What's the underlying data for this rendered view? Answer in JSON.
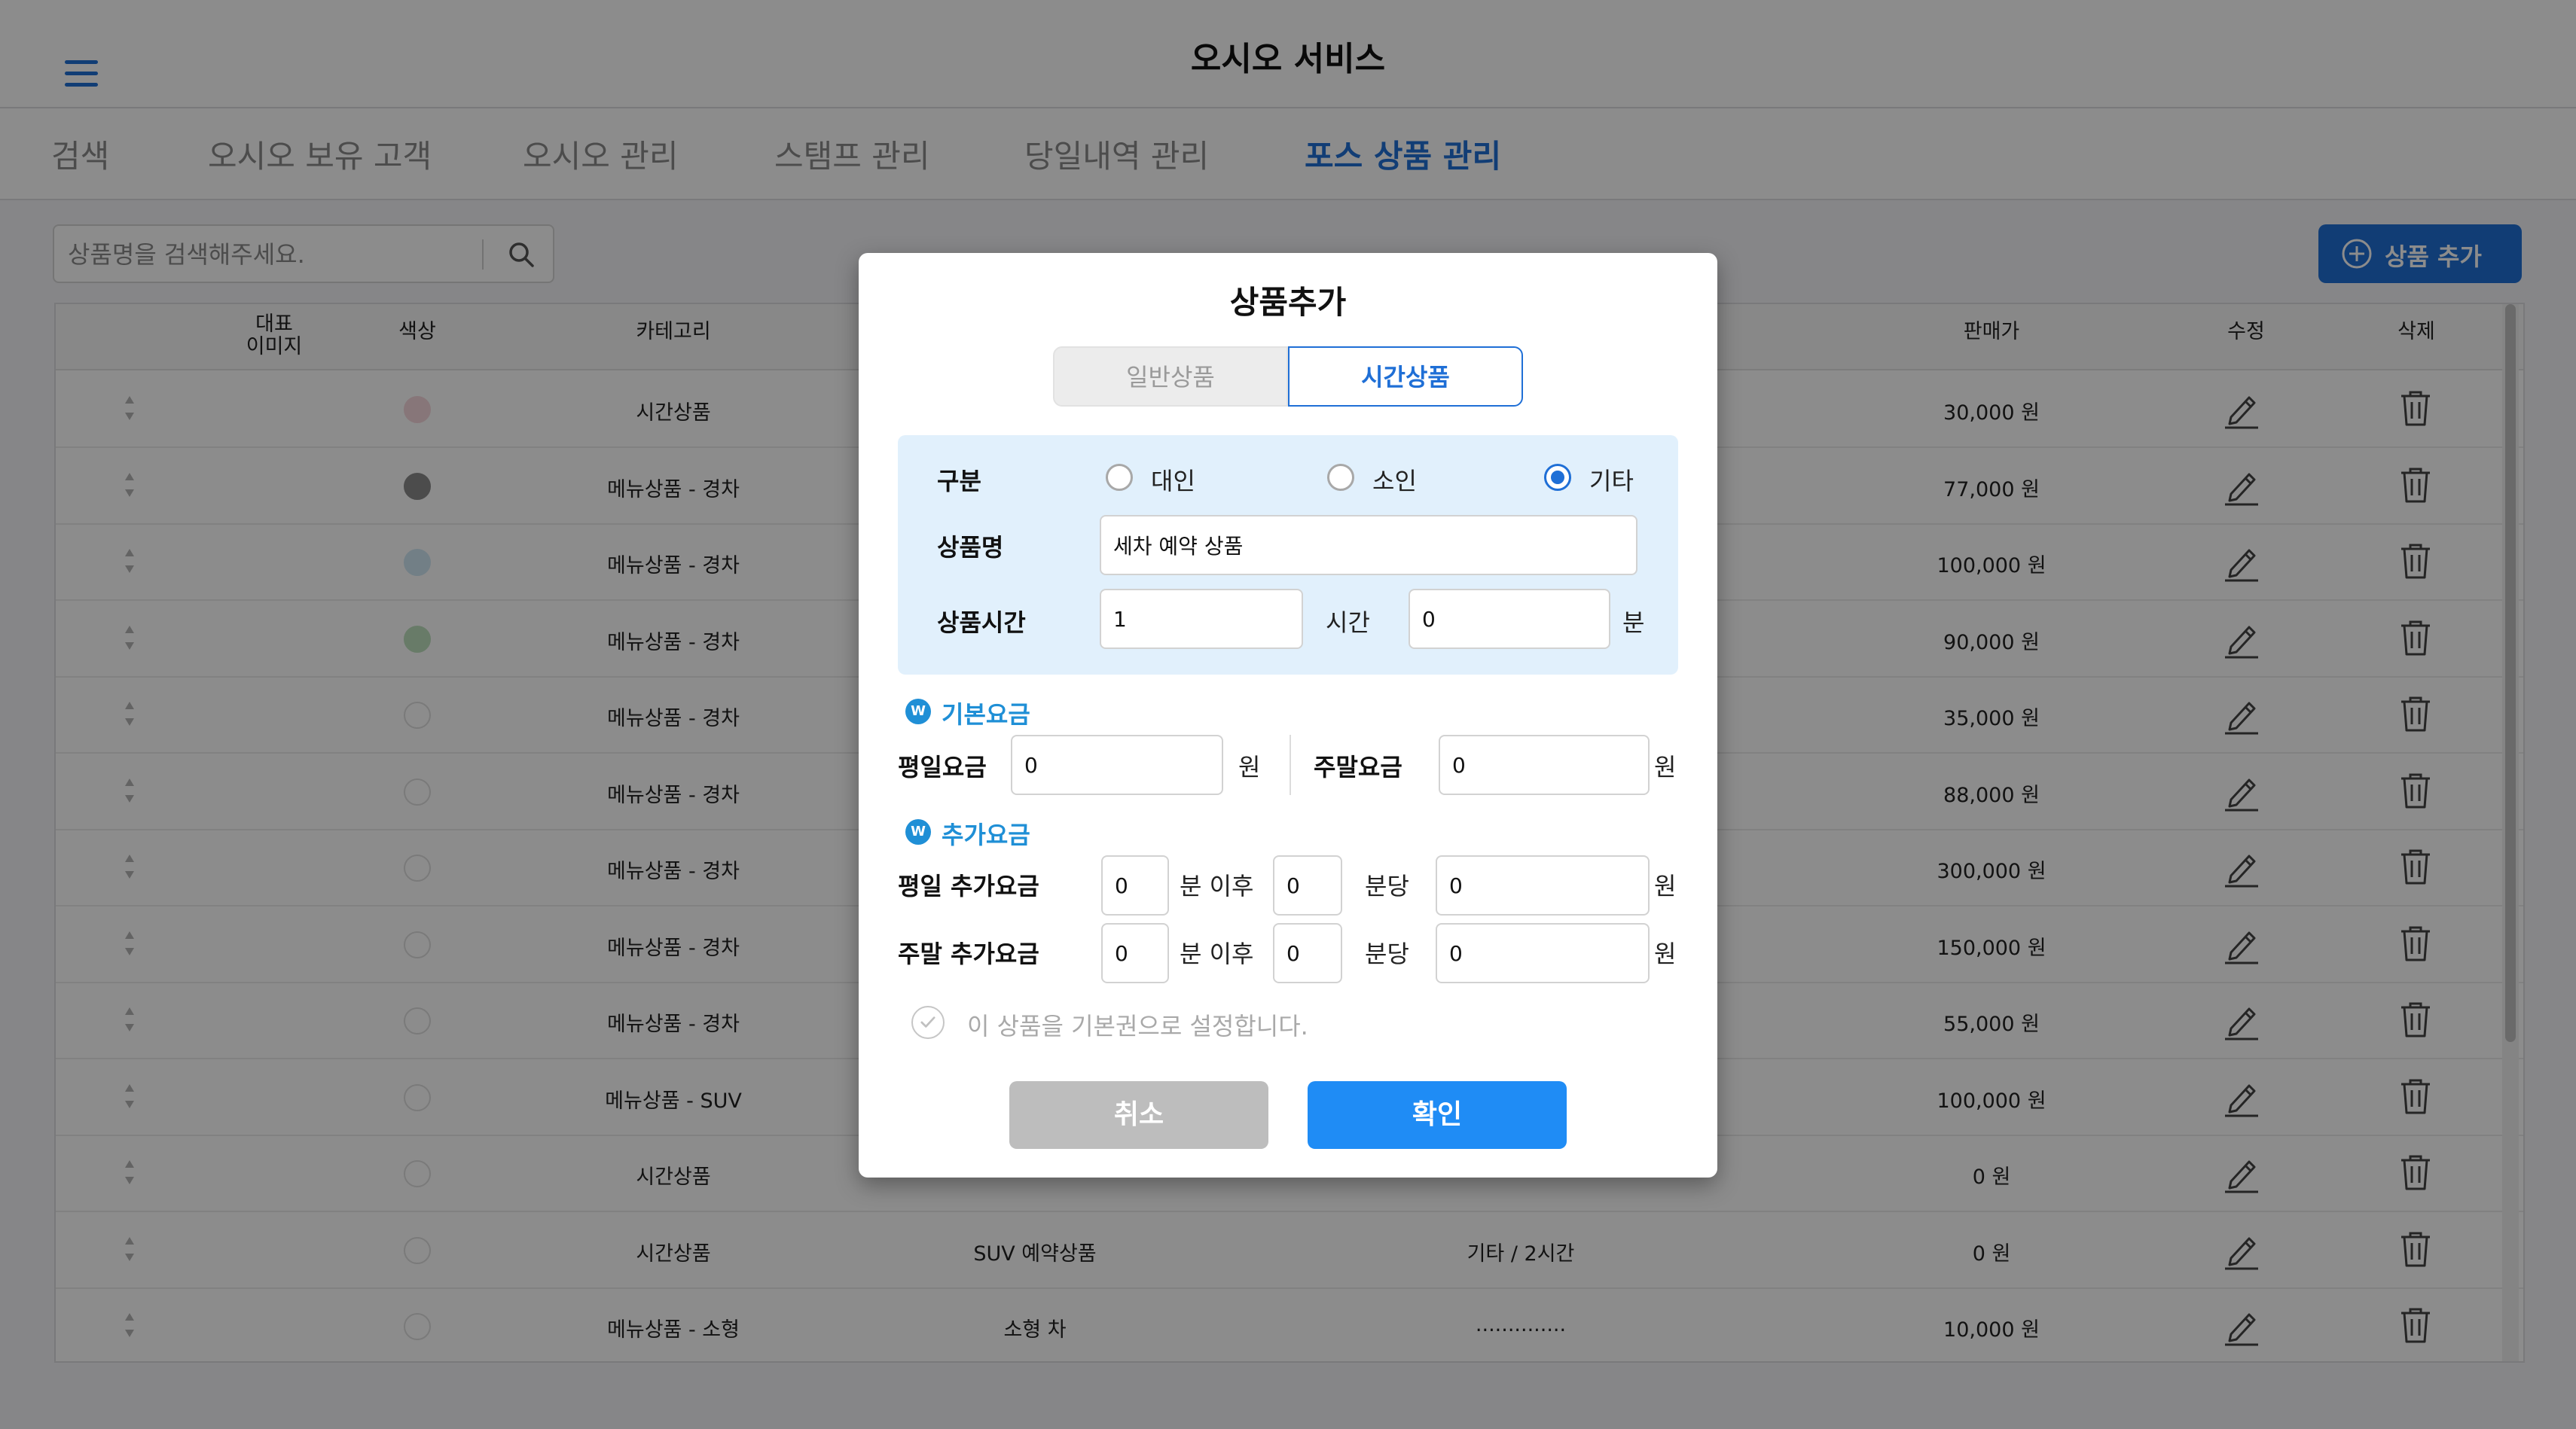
{
  "app": {
    "title": "오시오 서비스"
  },
  "tabs": [
    {
      "label": "검색",
      "active": false
    },
    {
      "label": "오시오 보유 고객",
      "active": false
    },
    {
      "label": "오시오 관리",
      "active": false
    },
    {
      "label": "스탬프 관리",
      "active": false
    },
    {
      "label": "당일내역 관리",
      "active": false
    },
    {
      "label": "포스 상품 관리",
      "active": true
    }
  ],
  "toolbar": {
    "search_placeholder": "상품명을 검색해주세요.",
    "add_label": "상품 추가"
  },
  "table": {
    "headers": {
      "image_line1": "대표",
      "image_line2": "이미지",
      "color": "색상",
      "category": "카테고리",
      "price": "판매가",
      "edit": "수정",
      "delete": "삭제"
    },
    "rows": [
      {
        "color": "#f6d7dc",
        "category": "시간상품",
        "name": "",
        "detail": "",
        "price": "30,000 원"
      },
      {
        "color": "#8a8a8a",
        "category": "메뉴상품 - 경차",
        "name": "",
        "detail": "",
        "price": "77,000 원"
      },
      {
        "color": "#cfe8f5",
        "category": "메뉴상품 - 경차",
        "name": "",
        "detail": "",
        "price": "100,000 원"
      },
      {
        "color": "#bde0bd",
        "category": "메뉴상품 - 경차",
        "name": "",
        "detail": "",
        "price": "90,000 원"
      },
      {
        "color": "#ffffff",
        "category": "메뉴상품 - 경차",
        "name": "",
        "detail": "",
        "price": "35,000 원"
      },
      {
        "color": "#ffffff",
        "category": "메뉴상품 - 경차",
        "name": "",
        "detail": "",
        "price": "88,000 원"
      },
      {
        "color": "#ffffff",
        "category": "메뉴상품 - 경차",
        "name": "",
        "detail": "",
        "price": "300,000 원"
      },
      {
        "color": "#ffffff",
        "category": "메뉴상품 - 경차",
        "name": "",
        "detail": "",
        "price": "150,000 원"
      },
      {
        "color": "#ffffff",
        "category": "메뉴상품 - 경차",
        "name": "",
        "detail": "",
        "price": "55,000 원"
      },
      {
        "color": "#ffffff",
        "category": "메뉴상품 - SUV",
        "name": "",
        "detail": "",
        "price": "100,000 원"
      },
      {
        "color": "#ffffff",
        "category": "시간상품",
        "name": "",
        "detail": "",
        "price": "0 원"
      },
      {
        "color": "#ffffff",
        "category": "시간상품",
        "name": "SUV 예약상품",
        "detail": "기타 / 2시간",
        "price": "0 원"
      },
      {
        "color": "#ffffff",
        "category": "메뉴상품 - 소형",
        "name": "소형 차",
        "detail": "..............",
        "price": "10,000 원"
      }
    ]
  },
  "modal": {
    "title": "상품추가",
    "seg_general": "일반상품",
    "seg_time": "시간상품",
    "division_label": "구분",
    "radio_adult": "대인",
    "radio_child": "소인",
    "radio_other": "기타",
    "name_label": "상품명",
    "name_value": "세차 예약 상품",
    "time_label": "상품시간",
    "hours_value": "1",
    "hours_unit": "시간",
    "minutes_value": "0",
    "minutes_unit": "분",
    "won_symbol": "W",
    "basic_title": "기본요금",
    "weekday_fee_label": "평일요금",
    "weekday_fee_value": "0",
    "weekend_fee_label": "주말요금",
    "weekend_fee_value": "0",
    "won": "원",
    "extra_title": "추가요금",
    "weekday_extra_label": "평일 추가요금",
    "weekend_extra_label": "주말 추가요금",
    "after_min": "분 이후",
    "per_min": "분당",
    "wd_after": "0",
    "wd_per": "0",
    "wd_amount": "0",
    "we_after": "0",
    "we_per": "0",
    "we_amount": "0",
    "default_check": "이 상품을 기본권으로 설정합니다.",
    "cancel": "취소",
    "confirm": "확인"
  }
}
